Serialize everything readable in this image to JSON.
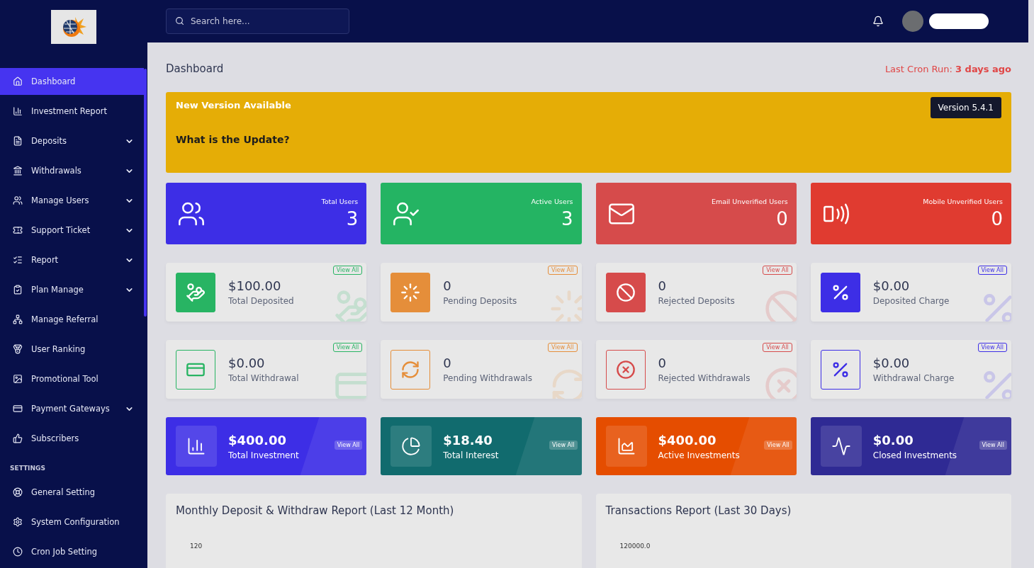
{
  "sidebar": {
    "items": [
      {
        "label": "Dashboard",
        "submenu": false,
        "selected": true
      },
      {
        "label": "Investment Report",
        "submenu": false,
        "selected": false
      },
      {
        "label": "Deposits",
        "submenu": true,
        "selected": false
      },
      {
        "label": "Withdrawals",
        "submenu": true,
        "selected": false
      },
      {
        "label": "Manage Users",
        "submenu": true,
        "selected": false
      },
      {
        "label": "Support Ticket",
        "submenu": true,
        "selected": false
      },
      {
        "label": "Report",
        "submenu": true,
        "selected": false
      },
      {
        "label": "Plan Manage",
        "submenu": true,
        "selected": false
      },
      {
        "label": "Manage Referral",
        "submenu": false,
        "selected": false
      },
      {
        "label": "User Ranking",
        "submenu": false,
        "selected": false
      },
      {
        "label": "Promotional Tool",
        "submenu": false,
        "selected": false
      },
      {
        "label": "Payment Gateways",
        "submenu": true,
        "selected": false
      },
      {
        "label": "Subscribers",
        "submenu": false,
        "selected": false
      }
    ],
    "section": "SETTINGS",
    "settings": [
      {
        "label": "General Setting",
        "submenu": false,
        "selected": false
      },
      {
        "label": "System Configuration",
        "submenu": false,
        "selected": false
      },
      {
        "label": "Cron Job Setting",
        "submenu": false,
        "selected": false
      }
    ]
  },
  "search": {
    "placeholder": "Search here..."
  },
  "page": {
    "title": "Dashboard",
    "cron_label": "Last Cron Run:",
    "cron_value": "3 days ago"
  },
  "banner": {
    "title": "New Version Available",
    "version": "Version 5.4.1",
    "question": "What is the Update?"
  },
  "user_stats": [
    {
      "label": "Total Users",
      "value": "3",
      "color": "#3d2ee6"
    },
    {
      "label": "Active Users",
      "value": "3",
      "color": "#24b463"
    },
    {
      "label": "Email Unverified Users",
      "value": "0",
      "color": "#d64b4b"
    },
    {
      "label": "Mobile Unverified Users",
      "value": "0",
      "color": "#e03b30"
    }
  ],
  "deposit_widgets": [
    {
      "value": "$100.00",
      "label": "Total Deposited",
      "kind": "filled",
      "color": "#28b463",
      "link": "View All"
    },
    {
      "value": "0",
      "label": "Pending Deposits",
      "kind": "filled",
      "color": "#e58e3a",
      "link": "View All"
    },
    {
      "value": "0",
      "label": "Rejected Deposits",
      "kind": "filled",
      "color": "#d64b4b",
      "link": "View All"
    },
    {
      "value": "$0.00",
      "label": "Deposited Charge",
      "kind": "filled",
      "color": "#3d2ee6",
      "link": "View All"
    }
  ],
  "withdraw_widgets": [
    {
      "value": "$0.00",
      "label": "Total Withdrawal",
      "kind": "outline",
      "color": "#28b463",
      "link": "View All"
    },
    {
      "value": "0",
      "label": "Pending Withdrawals",
      "kind": "outline",
      "color": "#e58e3a",
      "link": "View All"
    },
    {
      "value": "0",
      "label": "Rejected Withdrawals",
      "kind": "outline",
      "color": "#d64b4b",
      "link": "View All"
    },
    {
      "value": "$0.00",
      "label": "Withdrawal Charge",
      "kind": "outline",
      "color": "#3d2ee6",
      "link": "View All"
    }
  ],
  "investment_cards": [
    {
      "value": "$400.00",
      "label": "Total Investment",
      "color": "#3d2ee6",
      "link": "View All"
    },
    {
      "value": "$18.40",
      "label": "Total Interest",
      "color": "#116b6e",
      "link": "View All"
    },
    {
      "value": "$400.00",
      "label": "Active Investments",
      "color": "#e54d00",
      "link": "View All"
    },
    {
      "value": "$0.00",
      "label": "Closed Investments",
      "color": "#2f2a94",
      "link": "View All"
    }
  ],
  "charts": [
    {
      "title": "Monthly Deposit & Withdraw Report (Last 12 Month)",
      "y_tick": "120"
    },
    {
      "title": "Transactions Report (Last 30 Days)",
      "y_tick": "120000.0"
    }
  ]
}
